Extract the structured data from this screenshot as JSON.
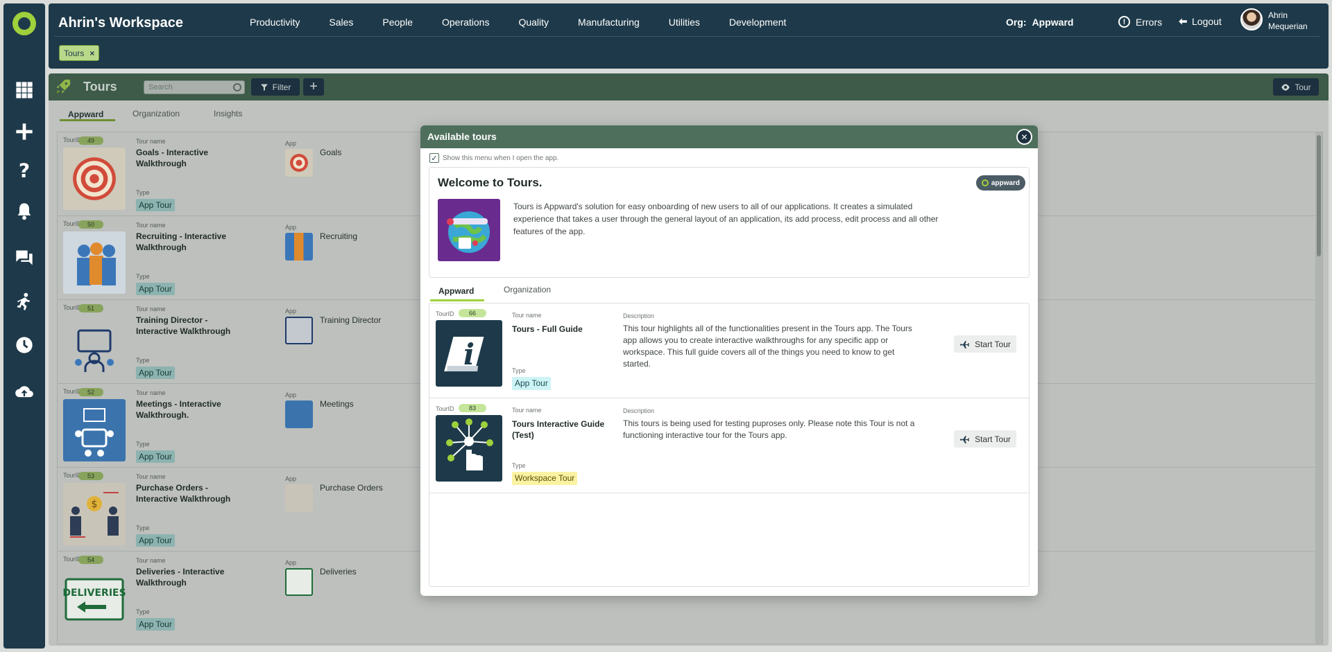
{
  "workspace": {
    "title": "Ahrin's Workspace"
  },
  "nav": [
    "Productivity",
    "Sales",
    "People",
    "Operations",
    "Quality",
    "Manufacturing",
    "Utilities",
    "Development"
  ],
  "org": {
    "label": "Org:",
    "value": "Appward"
  },
  "header_actions": {
    "errors": "Errors",
    "logout": "Logout"
  },
  "user": {
    "name": "Ahrin Mequerian"
  },
  "open_chip": {
    "label": "Tours",
    "close": "×"
  },
  "sidebar_icons": [
    "apps-grid-icon",
    "plus-icon",
    "help-icon",
    "bell-icon",
    "chat-icon",
    "running-icon",
    "clock-icon",
    "cloud-upload-icon"
  ],
  "app": {
    "title": "Tours",
    "search_placeholder": "Search",
    "filter_label": "Filter",
    "tour_label": "Tour",
    "tabs": [
      "Appward",
      "Organization",
      "Insights"
    ],
    "labels": {
      "tour_id": "TourID",
      "tour_name": "Tour name",
      "type": "Type",
      "app": "App"
    },
    "rows": [
      {
        "id": "49",
        "name": "Goals - Interactive Walkthrough",
        "type": "App Tour",
        "app": "Goals"
      },
      {
        "id": "50",
        "name": "Recruiting - Interactive Walkthrough",
        "type": "App Tour",
        "app": "Recruiting"
      },
      {
        "id": "51",
        "name": "Training Director - Interactive Walkthrough",
        "type": "App Tour",
        "app": "Training Director"
      },
      {
        "id": "52",
        "name": "Meetings - Interactive Walkthrough.",
        "type": "App Tour",
        "app": "Meetings"
      },
      {
        "id": "53",
        "name": "Purchase Orders - Interactive Walkthrough",
        "type": "App Tour",
        "app": "Purchase Orders"
      },
      {
        "id": "54",
        "name": "Deliveries - Interactive Walkthrough",
        "type": "App Tour",
        "app": "Deliveries"
      }
    ]
  },
  "modal": {
    "title": "Available tours",
    "show_menu_label": "Show this menu when I open the app.",
    "welcome_title": "Welcome to Tours.",
    "brand": "appward",
    "welcome_text": "Tours is Appward's solution for easy onboarding of new users to all of our applications. It creates a simulated experience that takes a user through the general layout of an application, its add process, edit process and all other features of the app.",
    "tabs": [
      "Appward",
      "Organization"
    ],
    "labels": {
      "tour_id": "TourID",
      "tour_name": "Tour name",
      "type": "Type",
      "description": "Description"
    },
    "start_label": "Start Tour",
    "tours": [
      {
        "id": "66",
        "name": "Tours - Full Guide",
        "type": "App Tour",
        "type_color": "#cdf3f5",
        "description": "This tour highlights all of the functionalities present in the Tours app. The Tours app allows you to create interactive walkthroughs for any specific app or workspace. This full guide covers all of the things you need to know to get started."
      },
      {
        "id": "83",
        "name": "Tours Interactive Guide (Test)",
        "type": "Workspace Tour",
        "type_color": "#fbf3a3",
        "description": "This tours is being used for testing puproses only. Please note this Tour is not a functioning interactive tour for the Tours app."
      }
    ]
  },
  "colors": {
    "navy": "#1e3a4a",
    "accent": "#9fd13c",
    "header_green": "#4e6f5c"
  }
}
